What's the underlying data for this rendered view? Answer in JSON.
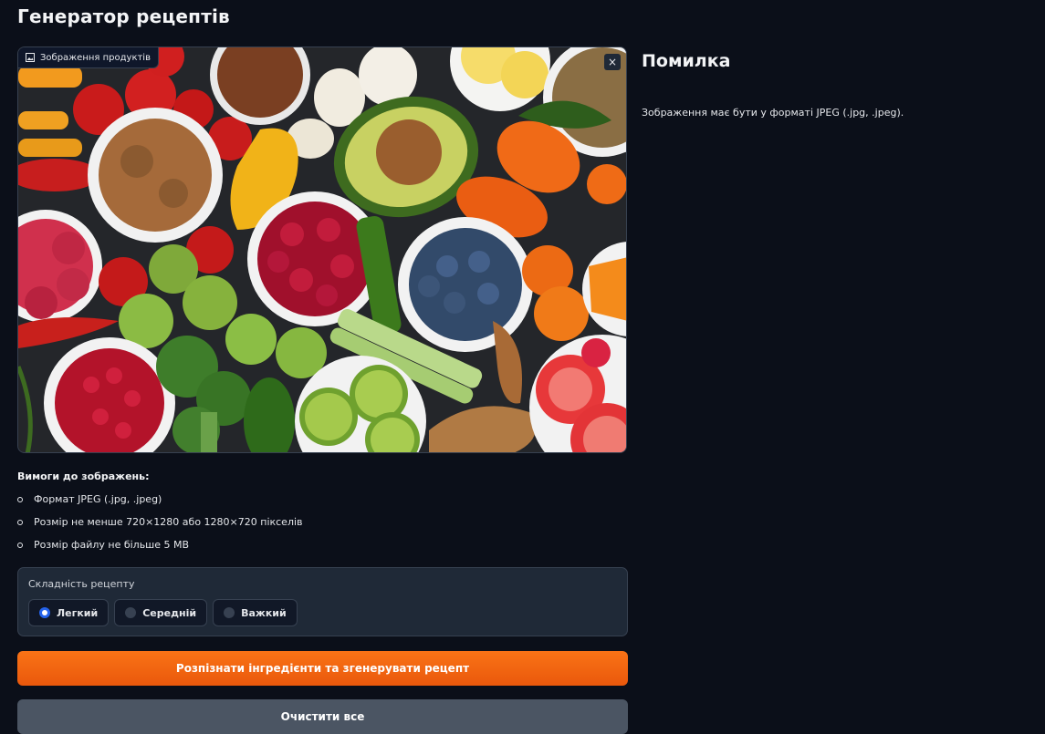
{
  "title": "Генератор рецептів",
  "image_panel": {
    "label": "Зображення продуктів",
    "label_icon": "image-icon",
    "close_icon": "close-icon",
    "close_symbol": "×"
  },
  "error": {
    "title": "Помилка",
    "message": "Зображення має бути у форматі JPEG (.jpg, .jpeg)."
  },
  "requirements": {
    "title": "Вимоги до зображень:",
    "items": [
      "Формат JPEG (.jpg, .jpeg)",
      "Розмір не менше 720×1280 або 1280×720 пікселів",
      "Розмір файлу не більше 5 MB"
    ]
  },
  "difficulty": {
    "label": "Складність рецепту",
    "options": [
      {
        "label": "Легкий",
        "selected": true
      },
      {
        "label": "Середній",
        "selected": false
      },
      {
        "label": "Важкий",
        "selected": false
      }
    ]
  },
  "buttons": {
    "submit": "Розпізнати інгредієнти та згенерувати рецепт",
    "clear": "Очистити все"
  },
  "colors": {
    "background": "#0b0f19",
    "accent": "#f97316",
    "radio_selected": "#2563eb"
  }
}
